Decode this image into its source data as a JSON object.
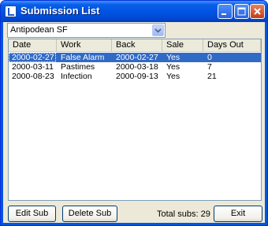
{
  "window": {
    "title": "Submission List"
  },
  "market_select": {
    "value": "Antipodean SF"
  },
  "table": {
    "columns": [
      "Date",
      "Work",
      "Back",
      "Sale",
      "Days Out"
    ],
    "rows": [
      {
        "date": "2000-02-27",
        "work": "False Alarm",
        "back": "2000-02-27",
        "sale": "Yes",
        "days_out": "0",
        "selected": true
      },
      {
        "date": "2000-03-11",
        "work": "Pastimes",
        "back": "2000-03-18",
        "sale": "Yes",
        "days_out": "7",
        "selected": false
      },
      {
        "date": "2000-08-23",
        "work": "Infection",
        "back": "2000-09-13",
        "sale": "Yes",
        "days_out": "21",
        "selected": false
      }
    ]
  },
  "footer": {
    "edit_label": "Edit Sub",
    "delete_label": "Delete Sub",
    "total_label": "Total subs: 29",
    "exit_label": "Exit"
  },
  "colors": {
    "titlebar": "#0054e3",
    "selection": "#316ac5",
    "client_bg": "#ece9d8"
  },
  "icons": {
    "app": "list-icon",
    "minimize": "minimize-icon",
    "maximize": "maximize-icon",
    "close": "close-icon",
    "dropdown": "chevron-down-icon"
  }
}
